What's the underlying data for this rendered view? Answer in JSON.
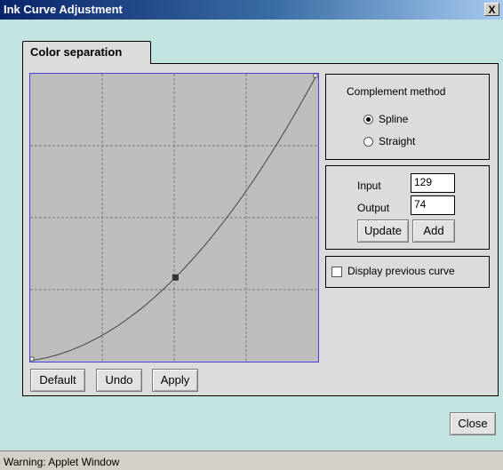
{
  "window": {
    "title": "Ink Curve Adjustment",
    "close_glyph": "X"
  },
  "tab": {
    "label": "Color separation"
  },
  "curve": {
    "grid_divisions": 4,
    "grid_color": "#7a7a7a",
    "curve_color": "#444444",
    "border_color": "#4444dd",
    "points": [
      [
        0,
        0
      ],
      [
        129,
        74
      ],
      [
        255,
        255
      ]
    ],
    "selected_point": [
      129,
      74
    ],
    "range": [
      0,
      255
    ]
  },
  "curve_buttons": {
    "default": "Default",
    "undo": "Undo",
    "apply": "Apply"
  },
  "complement": {
    "title": "Complement method",
    "options": [
      "Spline",
      "Straight"
    ],
    "selected": "Spline"
  },
  "point_editor": {
    "input_label": "Input",
    "input_value": "129",
    "output_label": "Output",
    "output_value": "74",
    "update_label": "Update",
    "add_label": "Add"
  },
  "display_previous": {
    "label": "Display previous curve",
    "checked": false
  },
  "close_button": "Close",
  "status": "Warning: Applet Window"
}
